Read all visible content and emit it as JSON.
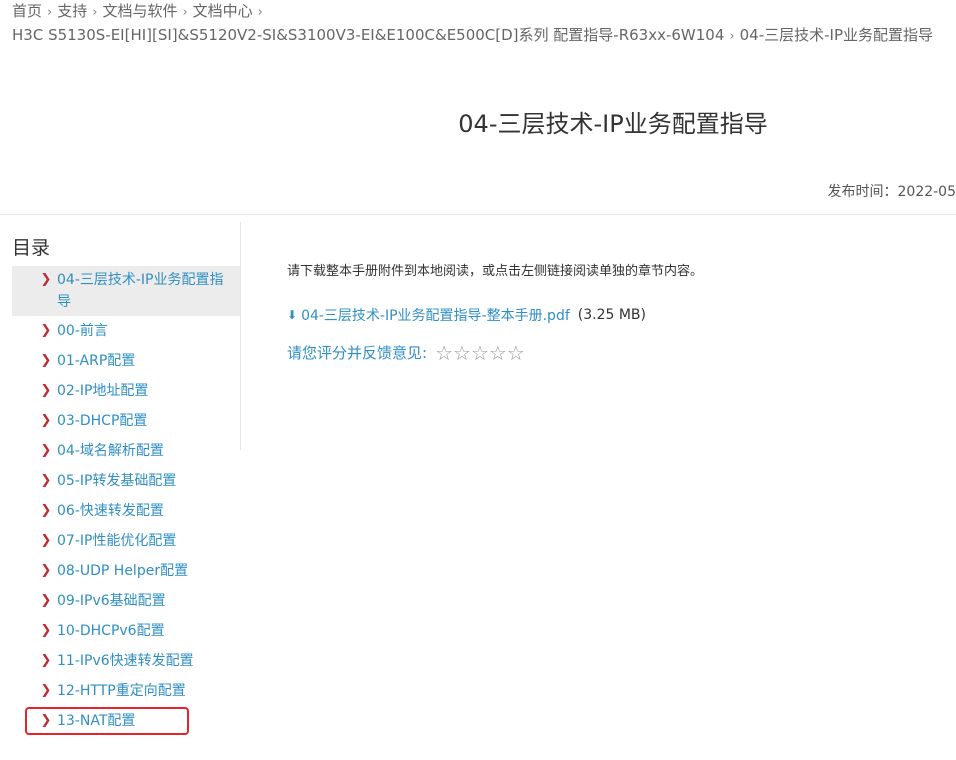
{
  "breadcrumb": {
    "items": [
      "首页",
      "支持",
      "文档与软件",
      "文档中心",
      "H3C S5130S-EI[HI][SI]&S5120V2-SI&S3100V3-EI&E100C&E500C[D]系列 配置指导-R63xx-6W104",
      "04-三层技术-IP业务配置指导"
    ],
    "separator": "›"
  },
  "document": {
    "title": "04-三层技术-IP业务配置指导",
    "publish_label": "发布时间：2022-05"
  },
  "toc": {
    "title": "目录",
    "items": [
      "04-三层技术-IP业务配置指导",
      "00-前言",
      "01-ARP配置",
      "02-IP地址配置",
      "03-DHCP配置",
      "04-域名解析配置",
      "05-IP转发基础配置",
      "06-快速转发配置",
      "07-IP性能优化配置",
      "08-UDP Helper配置",
      "09-IPv6基础配置",
      "10-DHCPv6配置",
      "11-IPv6快速转发配置",
      "12-HTTP重定向配置",
      "13-NAT配置"
    ]
  },
  "content": {
    "intro": "请下载整本手册附件到本地阅读，或点击左侧链接阅读单独的章节内容。",
    "download_link": "04-三层技术-IP业务配置指导-整本手册.pdf",
    "download_size": "(3.25 MB)",
    "rating_label": "请您评分并反馈意见:",
    "rating_stars": 5
  },
  "icons": {
    "chevron": "chevron-right-icon",
    "download": "download-icon",
    "star": "star-outline-icon"
  },
  "colors": {
    "link": "#2f8fc4",
    "chevron": "#c3292f",
    "highlight": "#e8232a",
    "active_bg": "#ececec"
  }
}
